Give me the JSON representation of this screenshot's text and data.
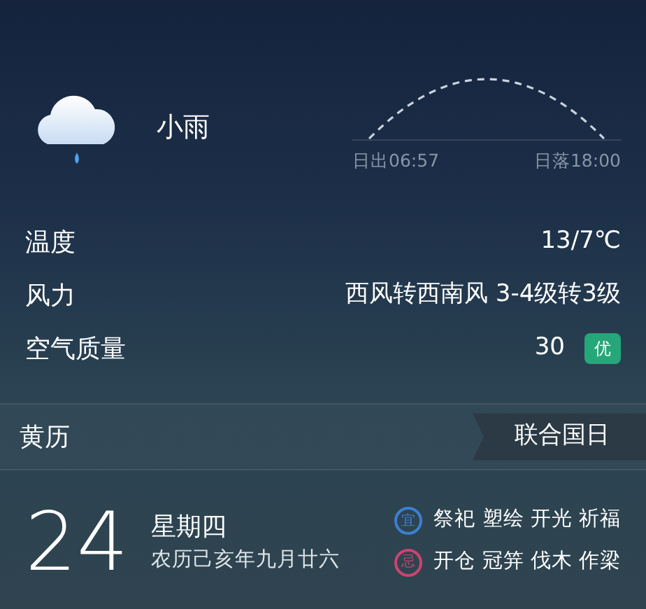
{
  "weather": {
    "condition": "小雨",
    "sunrise": "日出06:57",
    "sunset": "日落18:00"
  },
  "details": [
    {
      "label": "温度",
      "value": "13/7℃"
    },
    {
      "label": "风力",
      "value": "西风转西南风 3-4级转3级"
    },
    {
      "label": "空气质量",
      "value": "30",
      "badge": "优"
    }
  ],
  "almanac": {
    "title": "黄历",
    "festival": "联合国日",
    "day": "24",
    "weekday": "星期四",
    "lunar_date": "农历己亥年九月廿六",
    "lines": [
      {
        "mark": "宜",
        "color": "#3d7fd0",
        "text": "祭祀 塑绘 开光 祈福"
      },
      {
        "mark": "忌",
        "color": "#c9456f",
        "text": "开仓 冠笄 伐木 作梁"
      }
    ]
  }
}
